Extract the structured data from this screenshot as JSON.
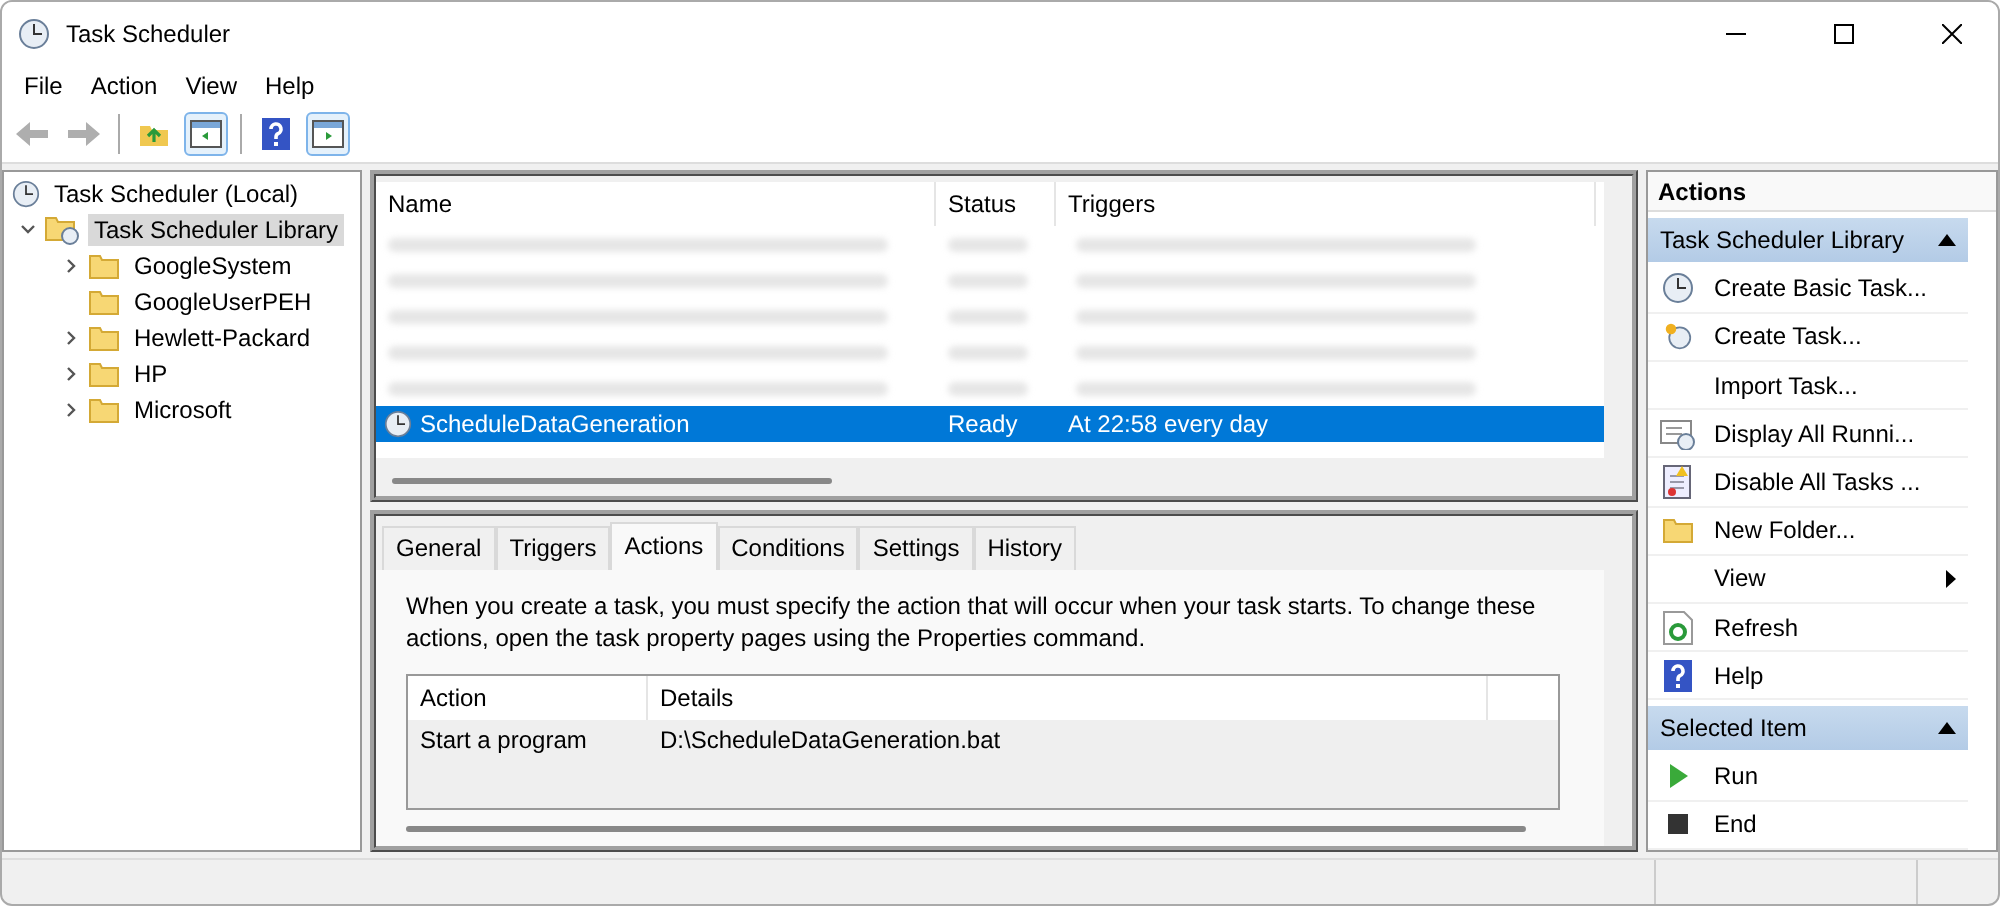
{
  "window": {
    "title": "Task Scheduler"
  },
  "menu": [
    "File",
    "Action",
    "View",
    "Help"
  ],
  "toolbar": [
    {
      "kind": "back",
      "disabled": true
    },
    {
      "kind": "forward",
      "disabled": true
    },
    {
      "kind": "sep"
    },
    {
      "kind": "up",
      "selected": false
    },
    {
      "kind": "pane",
      "selected": true
    },
    {
      "kind": "sep"
    },
    {
      "kind": "help",
      "selected": false
    },
    {
      "kind": "pane2",
      "selected": true
    }
  ],
  "tree": {
    "label": "Task Scheduler (Local)",
    "children": [
      {
        "label": "Task Scheduler Library",
        "expanded": true,
        "selected": true,
        "children": [
          {
            "label": "GoogleSystem",
            "has_children": true
          },
          {
            "label": "GoogleUserPEH",
            "has_children": false
          },
          {
            "label": "Hewlett-Packard",
            "has_children": true
          },
          {
            "label": "HP",
            "has_children": true
          },
          {
            "label": "Microsoft",
            "has_children": true
          }
        ]
      }
    ]
  },
  "task_list": {
    "columns": [
      "Name",
      "Status",
      "Triggers"
    ],
    "rows": [
      {
        "kind": "blurred",
        "selected": false
      },
      {
        "kind": "blurred",
        "selected": false
      },
      {
        "kind": "blurred",
        "selected": false
      },
      {
        "kind": "blurred",
        "selected": false
      },
      {
        "kind": "blurred",
        "selected": false
      },
      {
        "kind": "task",
        "selected": true,
        "name": "ScheduleDataGeneration",
        "status": "Ready",
        "triggers": "At 22:58 every day"
      }
    ]
  },
  "tabs": [
    {
      "label": "General",
      "selected": false
    },
    {
      "label": "Triggers",
      "selected": false
    },
    {
      "label": "Actions",
      "selected": true
    },
    {
      "label": "Conditions",
      "selected": false
    },
    {
      "label": "Settings",
      "selected": false
    },
    {
      "label": "History",
      "selected": false
    }
  ],
  "actions_tab": {
    "description": "When you create a task, you must specify the action that will occur when your task starts.  To change these actions, open the task property pages using the Properties command.",
    "columns": [
      "Action",
      "Details"
    ],
    "rows": [
      {
        "action": "Start a program",
        "details": "D:\\ScheduleDataGeneration.bat"
      }
    ]
  },
  "actions_pane": {
    "title": "Actions",
    "sections": [
      {
        "title": "Task Scheduler Library",
        "expanded": true,
        "items": [
          {
            "label": "Create Basic Task...",
            "kind": "basic",
            "submenu": false
          },
          {
            "label": "Create Task...",
            "kind": "task",
            "submenu": false
          },
          {
            "label": "Import Task...",
            "kind": "plain",
            "submenu": false
          },
          {
            "label": "Display All Runni...",
            "kind": "display",
            "submenu": false
          },
          {
            "label": "Disable All Tasks ...",
            "kind": "disable",
            "submenu": false
          },
          {
            "label": "New Folder...",
            "kind": "folder",
            "submenu": false
          },
          {
            "label": "View",
            "kind": "plain",
            "submenu": true
          },
          {
            "label": "Refresh",
            "kind": "refresh",
            "submenu": false
          },
          {
            "label": "Help",
            "kind": "help",
            "submenu": false
          }
        ]
      },
      {
        "title": "Selected Item",
        "expanded": true,
        "items": [
          {
            "label": "Run",
            "kind": "run",
            "submenu": false
          },
          {
            "label": "End",
            "kind": "end",
            "submenu": false
          }
        ]
      }
    ]
  }
}
